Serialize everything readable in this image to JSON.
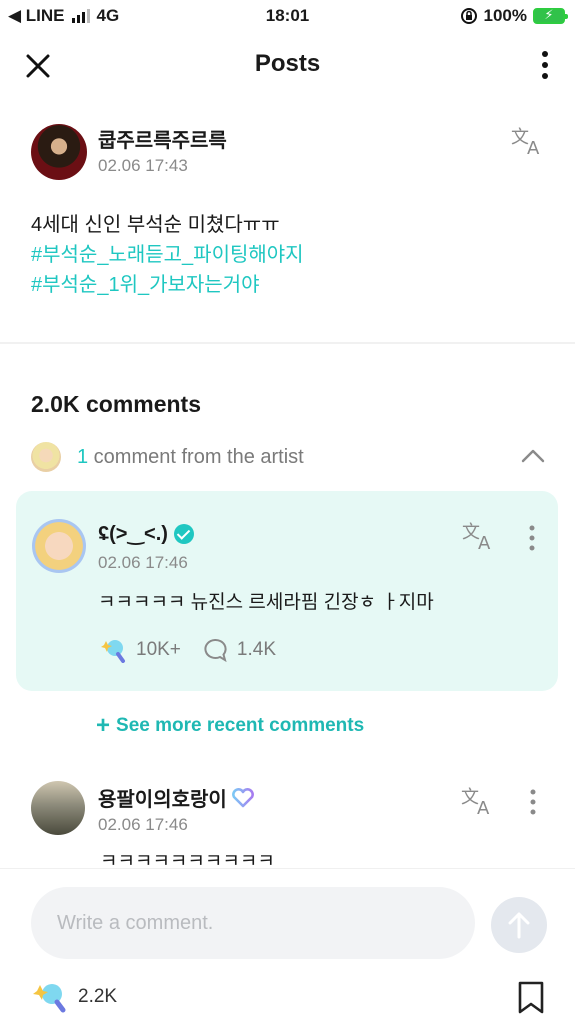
{
  "status_bar": {
    "back_app": "◀ LINE",
    "network": "4G",
    "time": "18:01",
    "battery": "100%"
  },
  "header": {
    "title": "Posts"
  },
  "post": {
    "author": "쿱주르륵주르륵",
    "time": "02.06 17:43",
    "body_line": "4세대 신인 부석순 미쳤다ㅠㅠ",
    "hashtags": [
      "#부석순_노래듣고_파이팅해야지",
      "#부석순_1위_가보자는거야"
    ]
  },
  "comments": {
    "count_label": "2.0K comments",
    "artist_count": "1",
    "artist_label": " comment from the artist",
    "artist_comment": {
      "name": "ʢ(>‿<.)",
      "time": "02.06 17:46",
      "text": "ㅋㅋㅋㅋㅋ 뉴진스 르세라핌 긴장ㅎ ㅏ지마",
      "lights": "10K+",
      "replies": "1.4K"
    },
    "see_more": "See more recent comments",
    "items": [
      {
        "name": "용팔이의호랑이",
        "time": "02.06 17:46",
        "text": "ㅋㅋㅋㅋㅋㅋㅋㅋㅋㅋ"
      }
    ]
  },
  "composer": {
    "placeholder": "Write a comment.",
    "likes": "2.2K"
  },
  "colors": {
    "accent": "#1fc7c1",
    "artist_card_bg": "#e6f9f5",
    "battery": "#31c24a"
  }
}
